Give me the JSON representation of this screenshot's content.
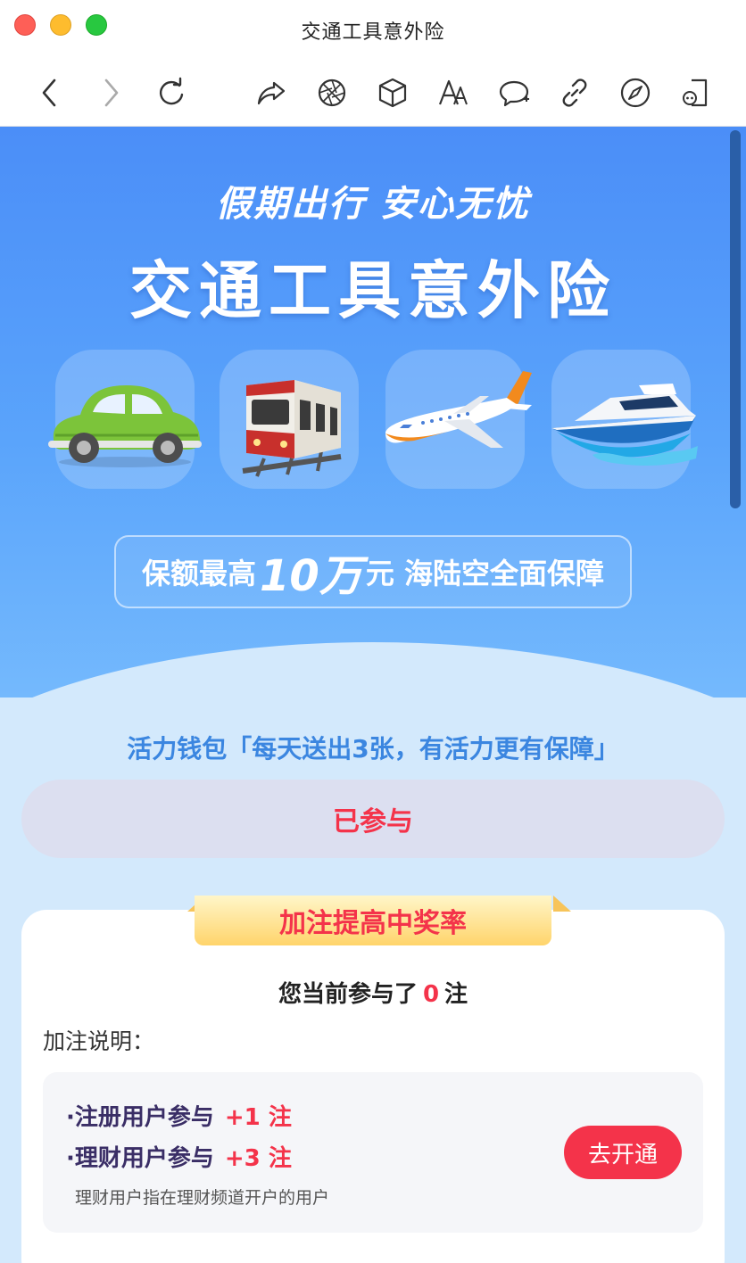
{
  "window": {
    "title": "交通工具意外险"
  },
  "toolbar": {
    "buttons": [
      "back-icon",
      "forward-icon",
      "reload-icon",
      "share-icon",
      "aperture-icon",
      "cube-icon",
      "font-size-icon",
      "chat-icon",
      "link-icon",
      "compass-icon",
      "phone-icon"
    ]
  },
  "hero": {
    "slogan": "假期出行 安心无忧",
    "title": "交通工具意外险",
    "vehicles": [
      "car",
      "train",
      "airplane",
      "boat"
    ],
    "coverage_prefix": "保额最高",
    "coverage_amount": "10万",
    "coverage_suffix": "元 海陆空全面保障"
  },
  "wallet": {
    "text": "活力钱包「每天送出3张，有活力更有保障」",
    "joined_label": "已参与"
  },
  "card": {
    "ribbon": "加注提高中奖率",
    "count_prefix": "您当前参与了",
    "count_value": "0",
    "count_suffix": "注",
    "explain_label": "加注说明：",
    "rules": [
      {
        "label": "·注册用户参与",
        "bonus": "+1 注"
      },
      {
        "label": "·理财用户参与",
        "bonus": "+3 注"
      }
    ],
    "note": "理财用户指在理财频道开户的用户",
    "open_button": "去开通"
  },
  "colors": {
    "accent": "#f4334a",
    "hero_blue": "#4b8ef8",
    "wallet_blue": "#3b86e0",
    "page_bg": "#d3e9fc"
  }
}
